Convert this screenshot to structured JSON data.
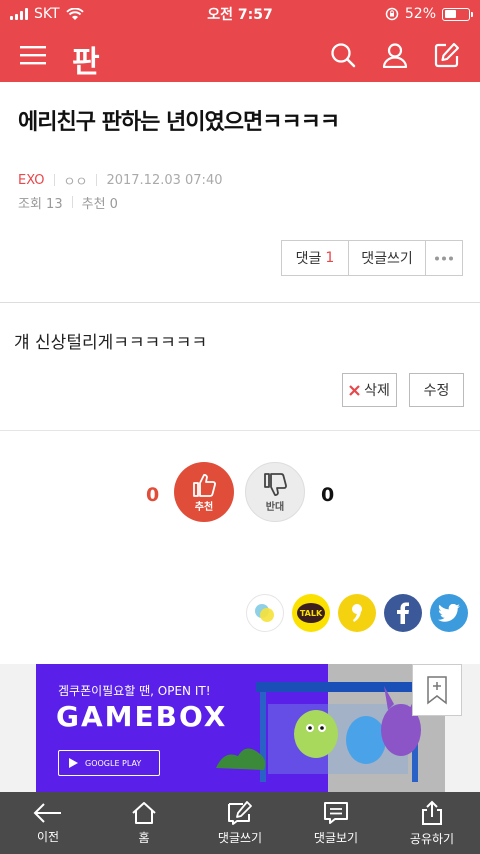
{
  "status_bar": {
    "carrier": "SKT",
    "time": "오전 7:57",
    "battery": "52%",
    "battery_level": 0.52
  },
  "nav": {
    "logo": "판"
  },
  "post": {
    "title": "에리친구 판하는 년이였으면ㅋㅋㅋㅋ",
    "category": "EXO",
    "author": "ㅇㅇ",
    "datetime": "2017.12.03 07:40",
    "views": "조회 13",
    "recommend": "추천 0",
    "comment_label": "댓글",
    "comment_count": "1",
    "write_comment_label": "댓글쓰기",
    "body": "걔 신상털리게ㅋㅋㅋㅋㅋㅋ",
    "delete_label": "삭제",
    "edit_label": "수정"
  },
  "vote": {
    "up_count": "0",
    "up_label": "추천",
    "down_count": "0",
    "down_label": "반대"
  },
  "share": {
    "kakaotalk_label": "TALK"
  },
  "ad": {
    "tagline": "겜쿠폰이필요할 땐, OPEN IT!",
    "brand": "GAMEBOX",
    "store": "GOOGLE PLAY"
  },
  "bottom_bar": {
    "items": [
      {
        "label": "이전"
      },
      {
        "label": "홈"
      },
      {
        "label": "댓글쓰기"
      },
      {
        "label": "댓글보기"
      },
      {
        "label": "공유하기"
      }
    ]
  },
  "colors": {
    "brand": "#e8474b",
    "upvote": "#e04e3a",
    "toolbar": "#4a4a4a",
    "ad": "#5a1fe8"
  }
}
